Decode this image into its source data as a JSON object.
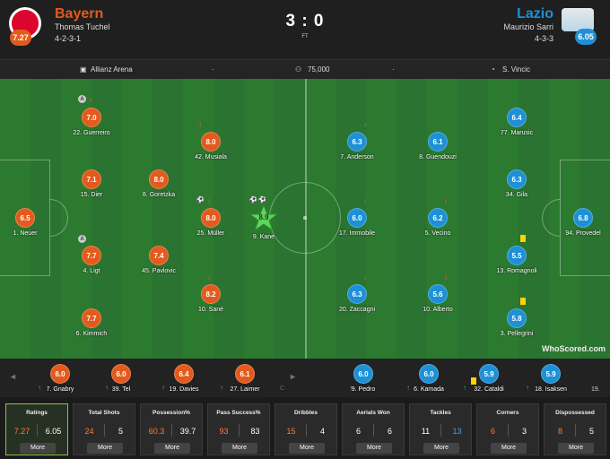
{
  "home": {
    "name": "Bayern",
    "coach": "Thomas Tuchel",
    "formation": "4-2-3-1",
    "rating": "7.27",
    "color": "#e25a1c",
    "crest_text": "FC BAYERN MÜNCHEN"
  },
  "away": {
    "name": "Lazio",
    "coach": "Maurizio Sarri",
    "formation": "4-3-3",
    "rating": "6.05",
    "color": "#1e90d6"
  },
  "score": "3 : 0",
  "status": "FT",
  "info": {
    "venue": "Allianz Arena",
    "attendance": "75,000",
    "referee": "S. Vincic",
    "venue_icon": "stadium-icon",
    "attendance_icon": "crowd-icon",
    "referee_icon": "whistle-icon"
  },
  "home_players": [
    {
      "num": "22",
      "name": "Guerreiro",
      "rating": "7.0",
      "icons": [
        "assist-icon",
        "subbed-off-arrow-icon"
      ]
    },
    {
      "num": "15",
      "name": "Dier",
      "rating": "7.1",
      "icons": []
    },
    {
      "num": "1",
      "name": "Neuer",
      "rating": "6.5",
      "icons": []
    },
    {
      "num": "4",
      "name": "Ligt",
      "rating": "7.7",
      "icons": [
        "assist-icon"
      ]
    },
    {
      "num": "6",
      "name": "Kimmich",
      "rating": "7.7",
      "icons": []
    },
    {
      "num": "8",
      "name": "Goretzka",
      "rating": "8.0",
      "icons": []
    },
    {
      "num": "45",
      "name": "Pavlovic",
      "rating": "7.4",
      "icons": []
    },
    {
      "num": "42",
      "name": "Musiala",
      "rating": "8.0",
      "icons": [
        "subbed-off-arrow-icon"
      ]
    },
    {
      "num": "25",
      "name": "Müller",
      "rating": "8.0",
      "icons": [
        "goal-icon",
        "subbed-off-arrow-icon"
      ]
    },
    {
      "num": "10",
      "name": "Sané",
      "rating": "8.2",
      "icons": [
        "subbed-off-arrow-icon"
      ]
    },
    {
      "num": "9",
      "name": "Kane",
      "rating": "8.9",
      "icons": [
        "goal-icon",
        "goal-icon",
        "man-of-the-match-star-icon"
      ]
    }
  ],
  "away_players": [
    {
      "num": "7",
      "name": "Anderson",
      "rating": "6.3",
      "icons": [
        "subbed-off-arrow-icon"
      ]
    },
    {
      "num": "17",
      "name": "Immobile",
      "rating": "6.0",
      "icons": [
        "subbed-off-arrow-icon"
      ]
    },
    {
      "num": "20",
      "name": "Zaccagni",
      "rating": "6.3",
      "icons": [
        "subbed-off-arrow-icon"
      ]
    },
    {
      "num": "8",
      "name": "Guendouzi",
      "rating": "6.1",
      "icons": []
    },
    {
      "num": "5",
      "name": "Vecino",
      "rating": "6.2",
      "icons": [
        "subbed-off-arrow-icon"
      ]
    },
    {
      "num": "10",
      "name": "Alberto",
      "rating": "5.6",
      "icons": [
        "subbed-off-arrow-icon"
      ]
    },
    {
      "num": "77",
      "name": "Marusic",
      "rating": "6.4",
      "icons": []
    },
    {
      "num": "34",
      "name": "Gila",
      "rating": "6.3",
      "icons": []
    },
    {
      "num": "13",
      "name": "Romagnoli",
      "rating": "5.5",
      "icons": [
        "yellow-card-icon"
      ]
    },
    {
      "num": "3",
      "name": "Pellegrini",
      "rating": "5.8",
      "icons": [
        "yellow-card-icon"
      ]
    },
    {
      "num": "94",
      "name": "Provedel",
      "rating": "6.8",
      "icons": []
    }
  ],
  "home_subs": [
    {
      "num": "7",
      "name": "Gnabry",
      "rating": "6.0"
    },
    {
      "num": "39",
      "name": "Tel",
      "rating": "6.0"
    },
    {
      "num": "19",
      "name": "Davies",
      "rating": "6.4"
    },
    {
      "num": "27",
      "name": "Laimer",
      "rating": "6.1"
    }
  ],
  "away_subs": [
    {
      "num": "9",
      "name": "Pedro",
      "rating": "6.0"
    },
    {
      "num": "6",
      "name": "Kamada",
      "rating": "6.0"
    },
    {
      "num": "32",
      "name": "Cataldi",
      "rating": "5.9"
    },
    {
      "num": "18",
      "name": "Isaksen",
      "rating": "5.9"
    }
  ],
  "bench_edge": {
    "left": "◄",
    "right": "►",
    "partial_right": "19.",
    "partial_left_icon": "C"
  },
  "stats": [
    {
      "title": "Ratings",
      "home": "7.27",
      "away": "6.05",
      "more": "More",
      "selected": true
    },
    {
      "title": "Total Shots",
      "home": "24",
      "away": "5",
      "more": "More"
    },
    {
      "title": "Possession%",
      "home": "60.3",
      "away": "39.7",
      "more": "More"
    },
    {
      "title": "Pass Success%",
      "home": "93",
      "away": "83",
      "more": "More"
    },
    {
      "title": "Dribbles",
      "home": "15",
      "away": "4",
      "more": "More"
    },
    {
      "title": "Aerials Won",
      "home": "6",
      "away": "6",
      "more": "More"
    },
    {
      "title": "Tackles",
      "home": "11",
      "away": "13",
      "more": "More"
    },
    {
      "title": "Corners",
      "home": "6",
      "away": "3",
      "more": "More"
    },
    {
      "title": "Dispossessed",
      "home": "8",
      "away": "5",
      "more": "More"
    }
  ],
  "watermark": "WhoScored.com"
}
